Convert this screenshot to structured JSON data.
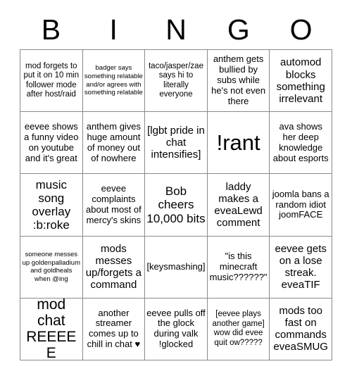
{
  "title": "BINGO",
  "header": {
    "letters": [
      "B",
      "I",
      "N",
      "G",
      "O"
    ]
  },
  "grid": {
    "columns": 5,
    "rows": 5,
    "cells": [
      {
        "text": "mod forgets to put it on 10 min follower mode after host/raid",
        "size": "fs-s"
      },
      {
        "text": "badger says something relatable and/or agrees with something relatable",
        "size": "fs-xs"
      },
      {
        "text": "taco/jasper/zae says hi to literally everyone",
        "size": "fs-s"
      },
      {
        "text": "anthem gets bullied by subs while he's not even there",
        "size": "fs-m"
      },
      {
        "text": "automod blocks something irrelevant",
        "size": "fs-l"
      },
      {
        "text": "eevee shows a funny video on youtube and it's great",
        "size": "fs-m"
      },
      {
        "text": "anthem gives huge amount of money out of nowhere",
        "size": "fs-m"
      },
      {
        "text": "[lgbt pride in chat intensifies]",
        "size": "fs-l"
      },
      {
        "text": "!rant",
        "size": "fs-huge"
      },
      {
        "text": "ava shows her deep knowledge about esports",
        "size": "fs-m"
      },
      {
        "text": "music song overlay :b:roke",
        "size": "fs-xl"
      },
      {
        "text": "eevee complaints about most of mercy's skins",
        "size": "fs-m"
      },
      {
        "text": "Bob cheers 10,000 bits",
        "size": "fs-xl"
      },
      {
        "text": "laddy makes a eveaLewd comment",
        "size": "fs-l"
      },
      {
        "text": "joomla bans a random idiot joomFACE",
        "size": "fs-m"
      },
      {
        "text": "someone messes up goldenpalladium and goldheals when @ing",
        "size": "fs-xs"
      },
      {
        "text": "mods messes up/forgets a command",
        "size": "fs-l"
      },
      {
        "text": "[keysmashing]",
        "size": "fs-m"
      },
      {
        "text": "\"is this minecraft music??????\"",
        "size": "fs-m"
      },
      {
        "text": "eevee gets on a lose streak. eveaTIF",
        "size": "fs-l"
      },
      {
        "text": "mod chat REEEEE",
        "size": "fs-xxl"
      },
      {
        "text": "another streamer comes up to chill in chat ♥",
        "size": "fs-m"
      },
      {
        "text": "eevee pulls off the glock during valk !glocked",
        "size": "fs-m"
      },
      {
        "text": "[eevee plays another game] wow did evee quit ow?????",
        "size": "fs-s"
      },
      {
        "text": "mods too fast on commands eveaSMUG",
        "size": "fs-l"
      }
    ]
  },
  "colors": {
    "background": "#ffffff",
    "text": "#000000",
    "grid_line": "#8a8a8a"
  }
}
